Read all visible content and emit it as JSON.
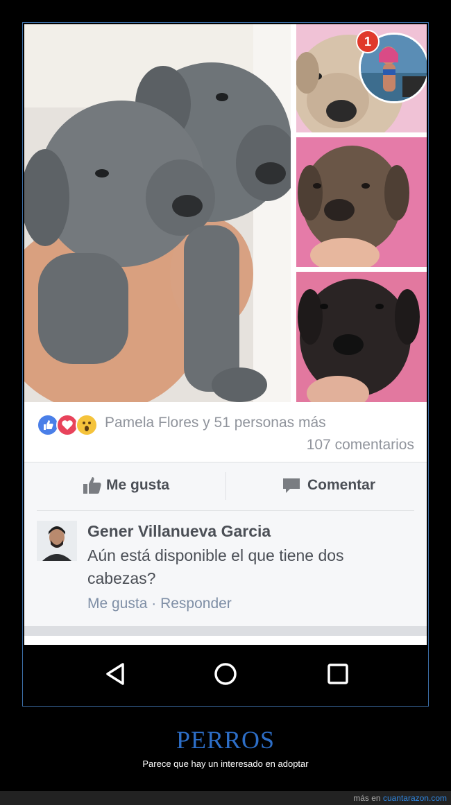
{
  "post": {
    "notification_count": "1",
    "reactions_text": "Pamela Flores y 51 personas más",
    "comments_count": "107 comentarios",
    "reaction_icons": [
      "like-icon",
      "love-icon",
      "wow-icon"
    ],
    "actions": {
      "like_label": "Me gusta",
      "comment_label": "Comentar"
    }
  },
  "comment": {
    "author": "Gener Villanueva Garcia",
    "text": "Aún está disponible el que tiene dos cabezas?",
    "like_label": "Me gusta",
    "separator": " · ",
    "reply_label": "Responder"
  },
  "navbar": {
    "icons": [
      "back-icon",
      "home-icon",
      "recent-apps-icon"
    ]
  },
  "caption": {
    "title": "PERROS",
    "subtitle": "Parece que hay un interesado en adoptar"
  },
  "footer": {
    "prefix": "más en ",
    "site": "cuantarazon.com"
  },
  "colors": {
    "accent": "#2d6ec7",
    "frame_border": "#3c6fa8",
    "notification": "#e0392b",
    "text_muted": "#90949c"
  }
}
